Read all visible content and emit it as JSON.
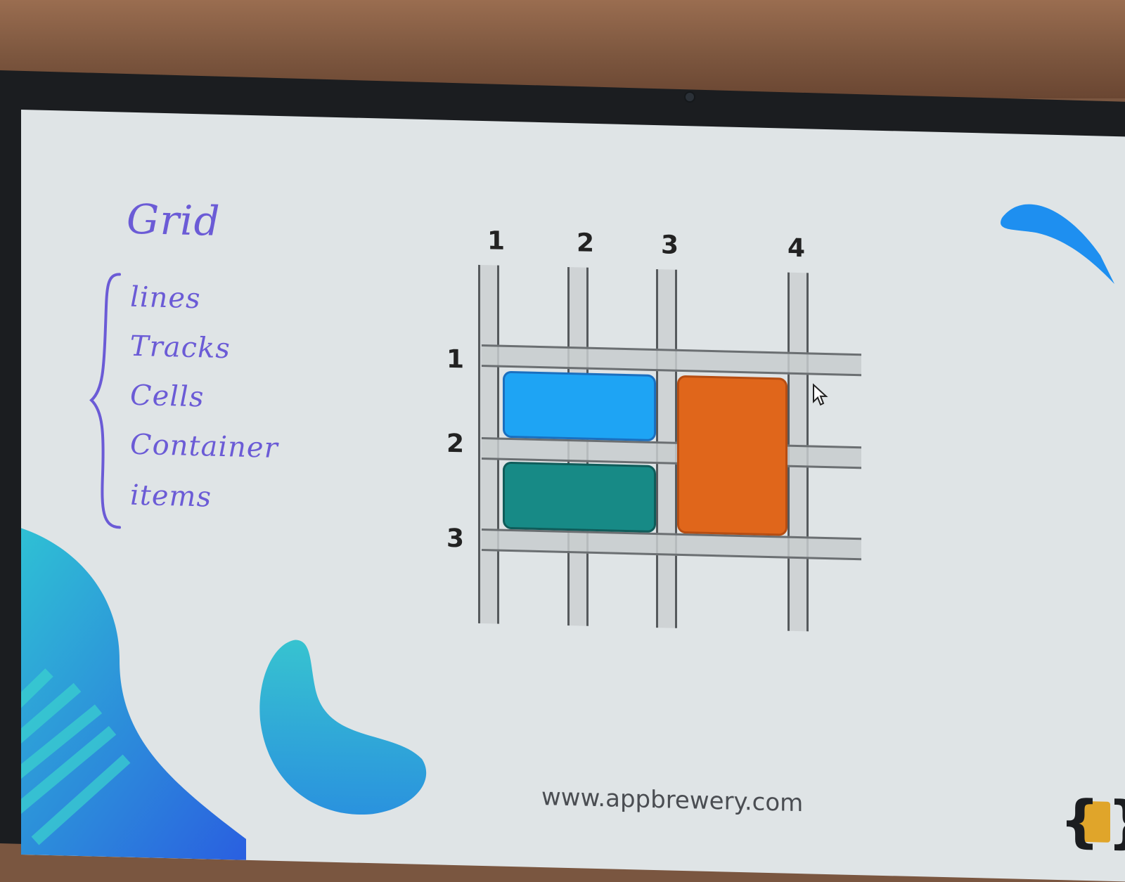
{
  "slide": {
    "handwritten_title": "Grid",
    "handwritten_items": [
      "lines",
      "Tracks",
      "Cells",
      "Container",
      "items"
    ],
    "footer_url": "www.appbrewery.com"
  },
  "diagram": {
    "column_line_labels": [
      "1",
      "2",
      "3",
      "4"
    ],
    "row_line_labels": [
      "1",
      "2",
      "3"
    ],
    "grid_items": [
      {
        "name": "blue-item",
        "color": "#1ea4f4",
        "column": "1 / 3",
        "row": "1 / 2"
      },
      {
        "name": "teal-item",
        "color": "#178a86",
        "column": "1 / 3",
        "row": "2 / 3"
      },
      {
        "name": "orange-item",
        "color": "#e0661b",
        "column": "3 / 4",
        "row": "1 / 3"
      }
    ]
  },
  "colors": {
    "handwriting": "#6b5bd6",
    "accent_blue": "#1e8ff0",
    "accent_teal": "#2fc0d0",
    "logo_yellow": "#e0a52a"
  },
  "icons": [
    "mouse-cursor-icon",
    "app-brewery-logo-icon",
    "curly-brace-icon"
  ]
}
